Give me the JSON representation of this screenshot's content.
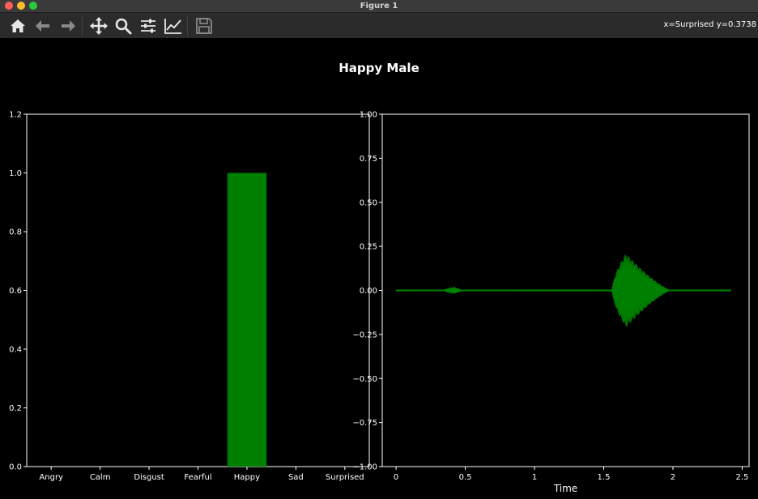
{
  "window": {
    "title": "Figure 1"
  },
  "toolbar": {
    "buttons": [
      {
        "icon": "home-icon"
      },
      {
        "icon": "back-arrow-icon"
      },
      {
        "icon": "forward-arrow-icon"
      },
      {
        "icon": "pan-icon"
      },
      {
        "icon": "zoom-icon"
      },
      {
        "icon": "subplots-config-icon"
      },
      {
        "icon": "edit-axes-icon"
      },
      {
        "icon": "save-icon"
      }
    ],
    "coords": "x=Surprised y=0.3738"
  },
  "figure": {
    "suptitle": "Happy Male"
  },
  "colors": {
    "background": "#000000",
    "bar": "#008000",
    "wave": "#008000",
    "axes": "#ffffff"
  },
  "chart_data": [
    {
      "type": "bar",
      "categories": [
        "Angry",
        "Calm",
        "Disgust",
        "Fearful",
        "Happy",
        "Sad",
        "Surprised"
      ],
      "values": [
        0,
        0,
        0,
        0,
        1.0,
        0,
        0
      ],
      "ylim": [
        0,
        1.2
      ],
      "yticks": [
        "0.0",
        "0.2",
        "0.4",
        "0.6",
        "0.8",
        "1.0",
        "1.2"
      ],
      "xlabel": "",
      "ylabel": ""
    },
    {
      "type": "line",
      "xlabel": "Time",
      "ylabel": "",
      "xlim": [
        -0.1,
        2.55
      ],
      "ylim": [
        -1.0,
        1.0
      ],
      "xticks": [
        "0",
        "0.5",
        "1",
        "1.5",
        "2",
        "2.5"
      ],
      "yticks": [
        "−1.00",
        "−0.75",
        "−0.50",
        "−0.25",
        "0.00",
        "0.25",
        "0.50",
        "0.75",
        "1.00"
      ],
      "series": [
        {
          "time_range": [
            0,
            2.42
          ],
          "bursts": [
            {
              "start": 0.34,
              "end": 0.5,
              "peak_time": 0.42,
              "amplitude": 0.02
            },
            {
              "start": 1.56,
              "end": 1.99,
              "peak_time": 1.66,
              "amplitude": 0.21,
              "min": -0.21
            }
          ]
        }
      ]
    }
  ]
}
